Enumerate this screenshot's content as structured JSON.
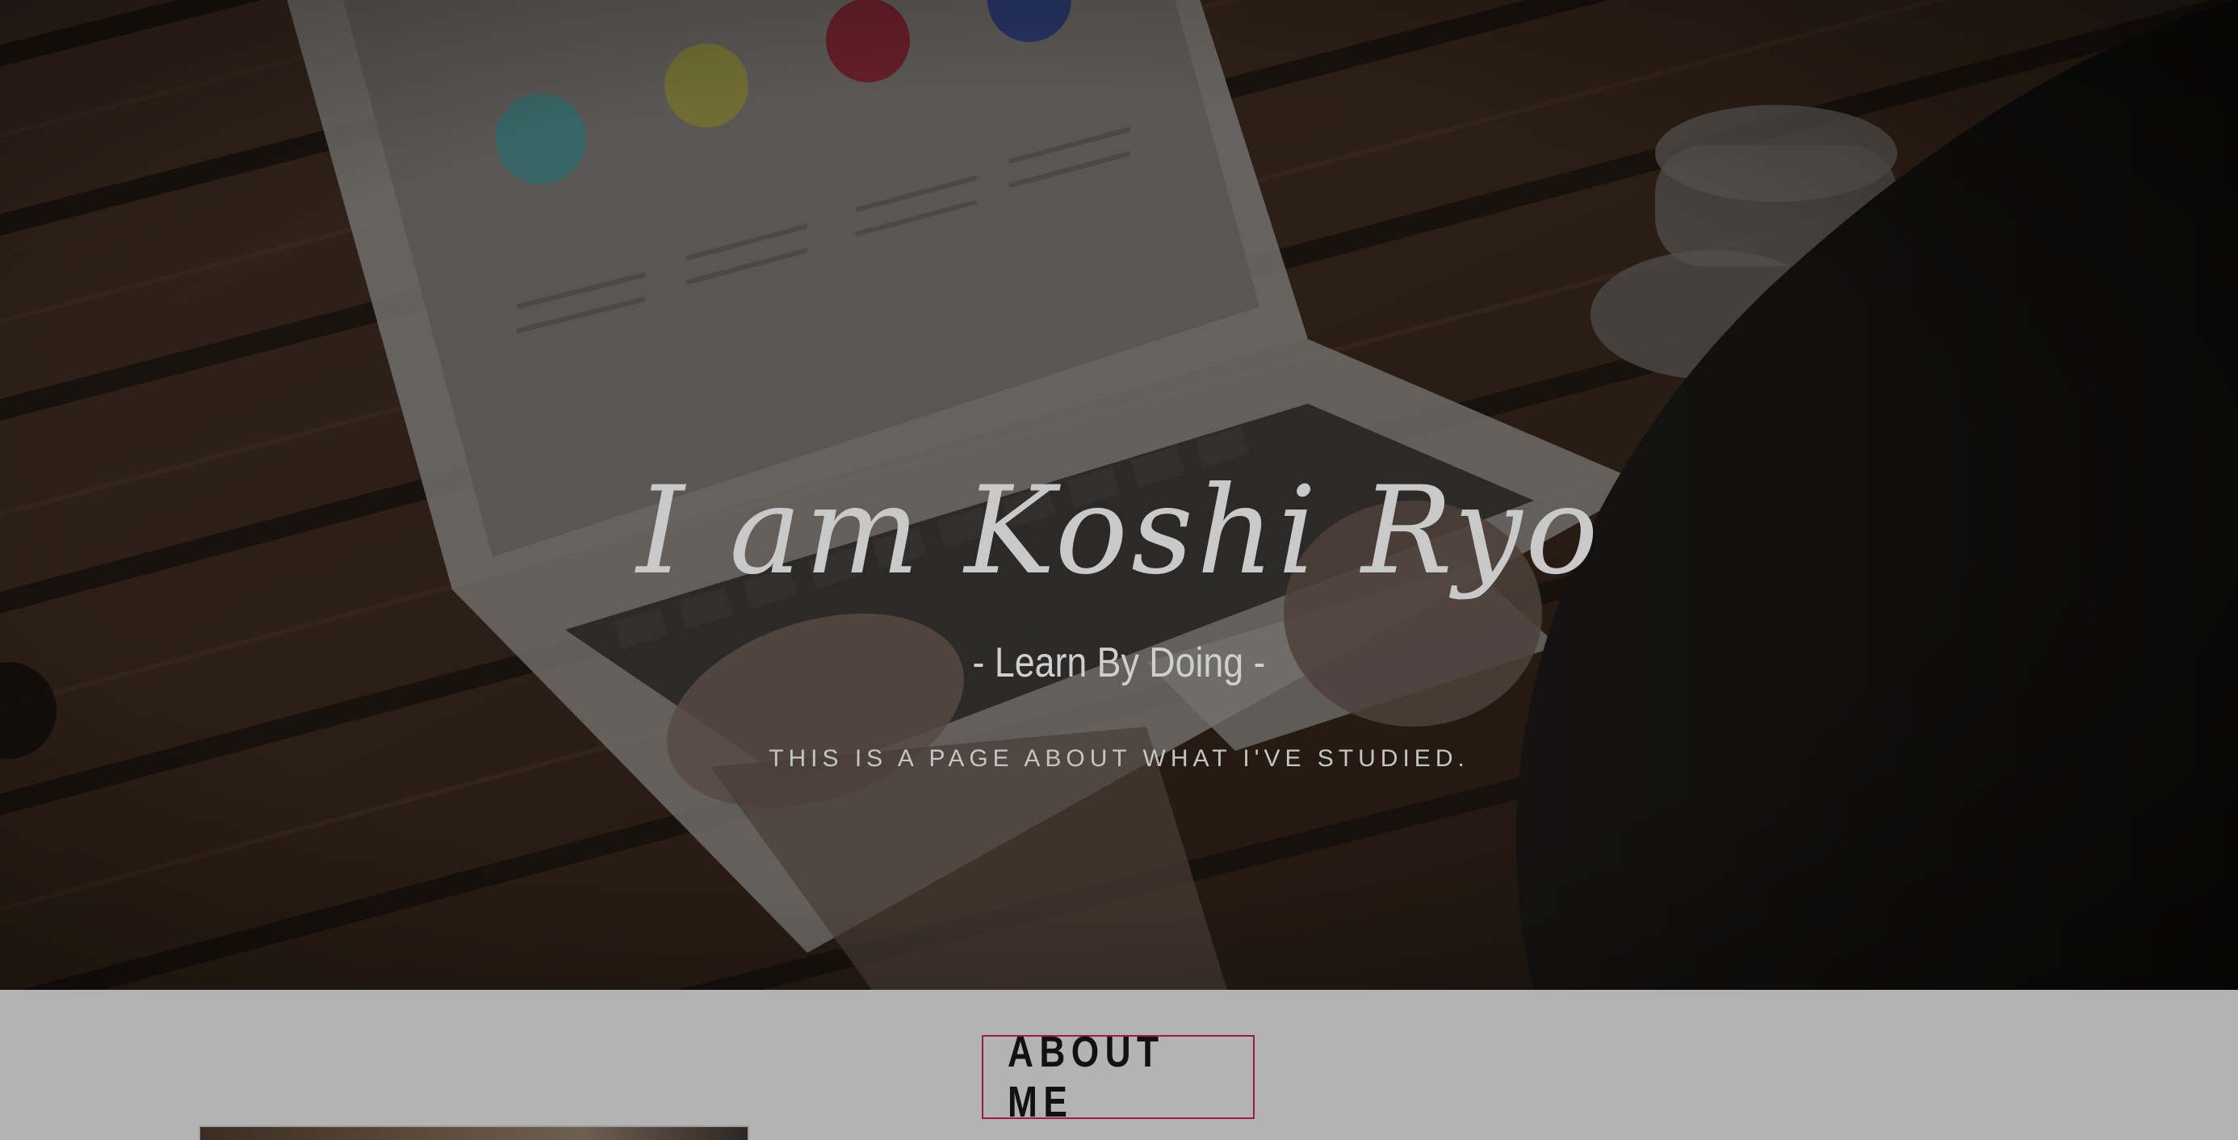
{
  "hero": {
    "title": "I am Koshi Ryo",
    "subtitle": "- Learn By Doing -",
    "tagline": "THIS IS A PAGE ABOUT WHAT I'VE STUDIED."
  },
  "about": {
    "heading": "ABOUT ME"
  },
  "colors": {
    "accent_border": "#9a1f3c",
    "section_bg": "#b3b3b3",
    "hero_text": "#c9c9c9"
  }
}
